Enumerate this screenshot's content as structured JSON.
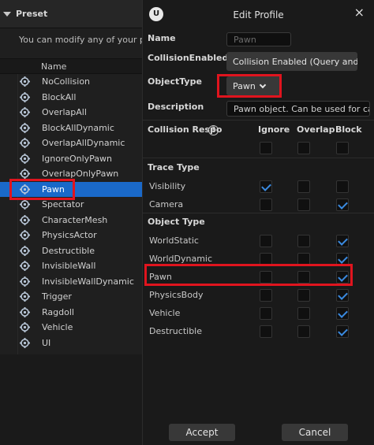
{
  "preset": {
    "header": "Preset",
    "description": "You can modify any of your pro",
    "column_name": "Name",
    "items": [
      {
        "label": "NoCollision",
        "selected": false
      },
      {
        "label": "BlockAll",
        "selected": false
      },
      {
        "label": "OverlapAll",
        "selected": false
      },
      {
        "label": "BlockAllDynamic",
        "selected": false
      },
      {
        "label": "OverlapAllDynamic",
        "selected": false
      },
      {
        "label": "IgnoreOnlyPawn",
        "selected": false
      },
      {
        "label": "OverlapOnlyPawn",
        "selected": false
      },
      {
        "label": "Pawn",
        "selected": true
      },
      {
        "label": "Spectator",
        "selected": false
      },
      {
        "label": "CharacterMesh",
        "selected": false
      },
      {
        "label": "PhysicsActor",
        "selected": false
      },
      {
        "label": "Destructible",
        "selected": false
      },
      {
        "label": "InvisibleWall",
        "selected": false
      },
      {
        "label": "InvisibleWallDynamic",
        "selected": false
      },
      {
        "label": "Trigger",
        "selected": false
      },
      {
        "label": "Ragdoll",
        "selected": false
      },
      {
        "label": "Vehicle",
        "selected": false
      },
      {
        "label": "UI",
        "selected": false
      }
    ]
  },
  "dialog": {
    "logo": "U",
    "title": "Edit Profile",
    "close": "×",
    "name_label": "Name",
    "name_placeholder": "Pawn",
    "collision_enabled_label": "CollisionEnabled",
    "collision_enabled_value": "Collision Enabled (Query and",
    "object_type_label": "ObjectType",
    "object_type_value": "Pawn",
    "description_label": "Description",
    "description_value": "Pawn object. Can be used for cap",
    "responses_header": "Collision Respo",
    "help": "?",
    "col_ignore": "Ignore",
    "col_overlap": "Overlap",
    "col_block": "Block",
    "trace_type_label": "Trace Type",
    "trace_channels": [
      {
        "label": "Visibility",
        "ignore": true,
        "overlap": false,
        "block": false
      },
      {
        "label": "Camera",
        "ignore": false,
        "overlap": false,
        "block": true
      }
    ],
    "object_type_group_label": "Object Type",
    "object_channels": [
      {
        "label": "WorldStatic",
        "ignore": false,
        "overlap": false,
        "block": true
      },
      {
        "label": "WorldDynamic",
        "ignore": false,
        "overlap": false,
        "block": true
      },
      {
        "label": "Pawn",
        "ignore": false,
        "overlap": false,
        "block": true
      },
      {
        "label": "PhysicsBody",
        "ignore": false,
        "overlap": false,
        "block": true
      },
      {
        "label": "Vehicle",
        "ignore": false,
        "overlap": false,
        "block": true
      },
      {
        "label": "Destructible",
        "ignore": false,
        "overlap": false,
        "block": true
      }
    ],
    "accept_label": "Accept",
    "cancel_label": "Cancel"
  },
  "colors": {
    "selection": "#1a69c9",
    "highlight": "#e0141e",
    "check": "#3a8ae0"
  },
  "icons": {
    "preset_item": "collision-preset-icon",
    "expand": "triangle-down-icon",
    "help": "help-circle-icon",
    "dropdown": "chevron-down-icon",
    "close": "close-icon"
  }
}
